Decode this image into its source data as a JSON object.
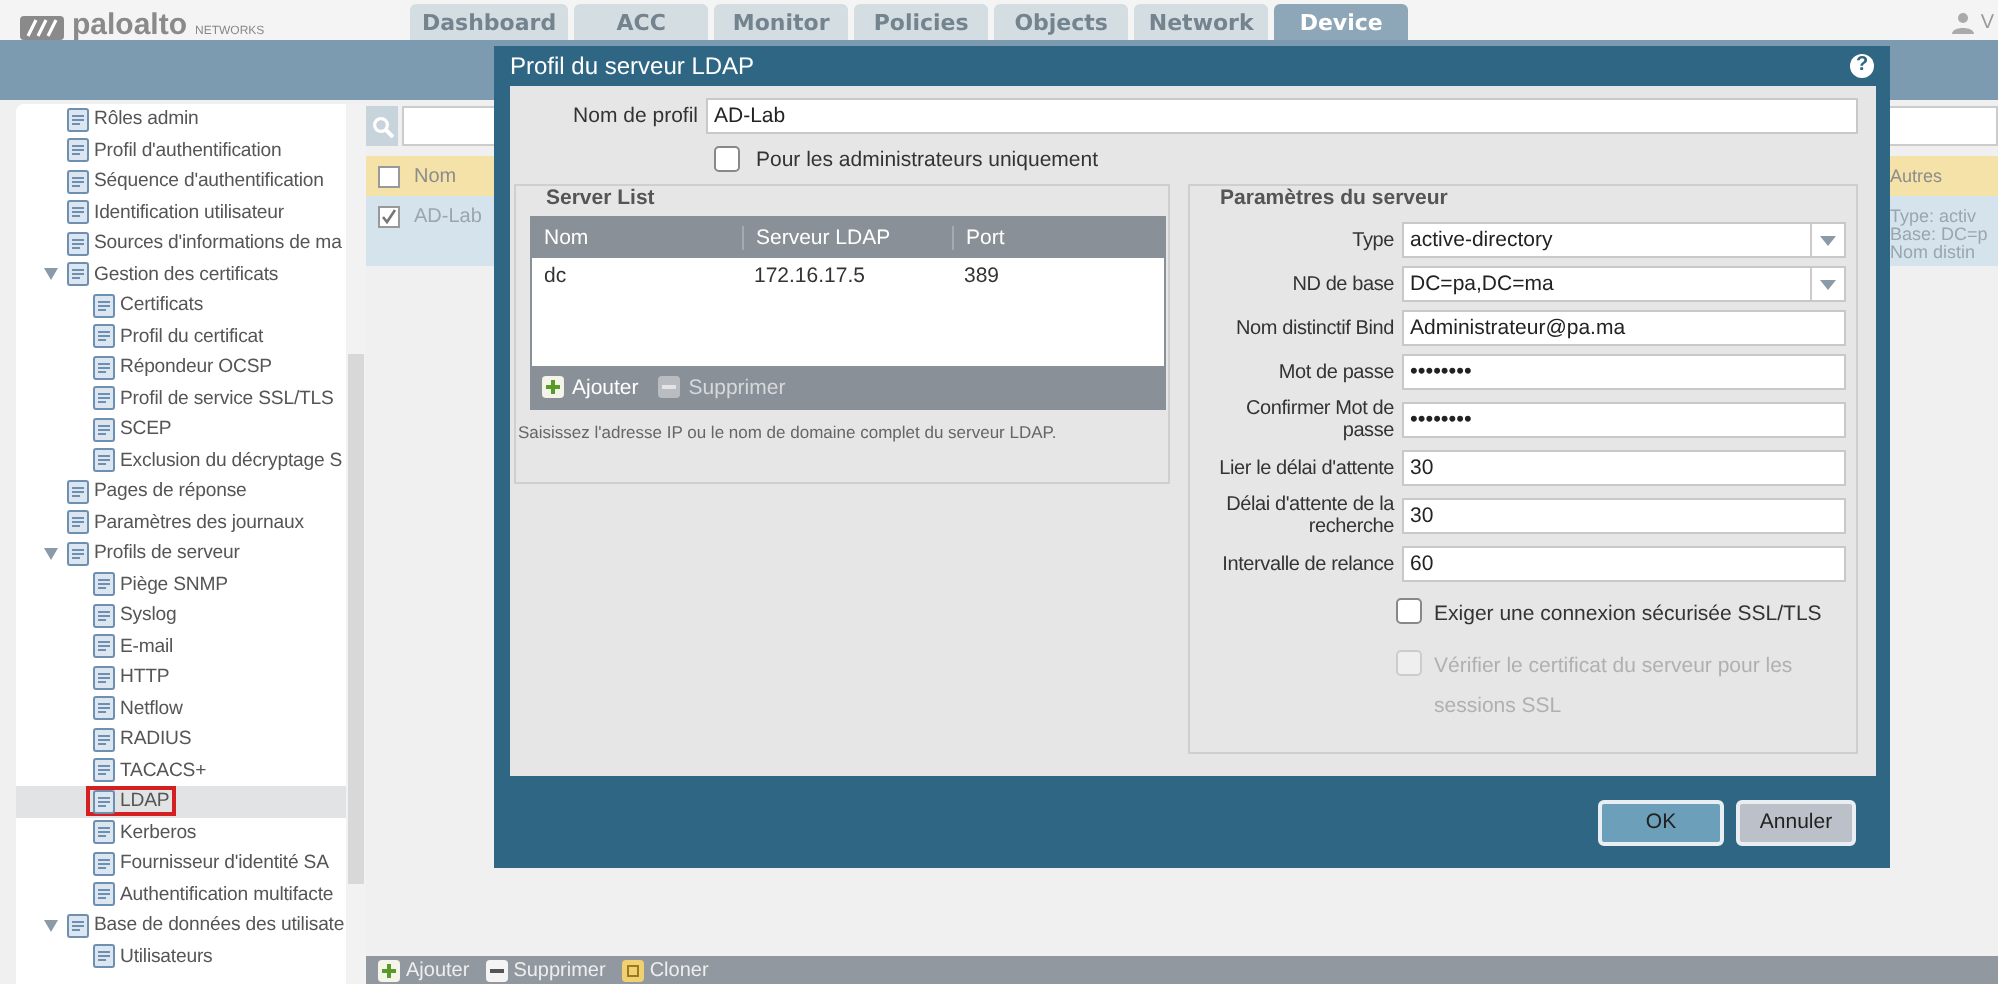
{
  "header": {
    "logo": {
      "wordmark": "paloalto",
      "tagline": "NETWORKS"
    },
    "tabs": [
      {
        "label": "Dashboard",
        "selected": false
      },
      {
        "label": "ACC",
        "selected": false
      },
      {
        "label": "Monitor",
        "selected": false
      },
      {
        "label": "Policies",
        "selected": false
      },
      {
        "label": "Objects",
        "selected": false
      },
      {
        "label": "Network",
        "selected": false
      },
      {
        "label": "Device",
        "selected": true
      }
    ],
    "user": "V"
  },
  "tree": {
    "items": [
      {
        "label": "Rôles admin",
        "selected": false
      },
      {
        "label": "Profil d'authentification",
        "selected": false
      },
      {
        "label": "Séquence d'authentification",
        "selected": false
      },
      {
        "label": "Identification utilisateur",
        "selected": false
      },
      {
        "label": "Sources d'informations de ma",
        "selected": false
      },
      {
        "label": "Gestion des certificats",
        "selected": false,
        "expanded": true,
        "children": [
          {
            "label": "Certificats",
            "selected": false
          },
          {
            "label": "Profil du certificat",
            "selected": false
          },
          {
            "label": "Répondeur OCSP",
            "selected": false
          },
          {
            "label": "Profil de service SSL/TLS",
            "selected": false
          },
          {
            "label": "SCEP",
            "selected": false
          },
          {
            "label": "Exclusion du décryptage S",
            "selected": false
          }
        ]
      },
      {
        "label": "Pages de réponse",
        "selected": false
      },
      {
        "label": "Paramètres des journaux",
        "selected": false
      },
      {
        "label": "Profils de serveur",
        "selected": false,
        "expanded": true,
        "children": [
          {
            "label": "Piège SNMP",
            "selected": false
          },
          {
            "label": "Syslog",
            "selected": false
          },
          {
            "label": "E-mail",
            "selected": false
          },
          {
            "label": "HTTP",
            "selected": false
          },
          {
            "label": "Netflow",
            "selected": false
          },
          {
            "label": "RADIUS",
            "selected": false
          },
          {
            "label": "TACACS+",
            "selected": false
          },
          {
            "label": "LDAP",
            "selected": true
          },
          {
            "label": "Kerberos",
            "selected": false
          },
          {
            "label": "Fournisseur d'identité SA",
            "selected": false
          },
          {
            "label": "Authentification multifacte",
            "selected": false
          }
        ]
      },
      {
        "label": "Base de données des utilisate",
        "selected": false,
        "expanded": true,
        "children": [
          {
            "label": "Utilisateurs",
            "selected": false
          }
        ]
      }
    ]
  },
  "main": {
    "table": {
      "header_checked": false,
      "columns": [
        "Nom",
        "Autres"
      ],
      "rows": [
        {
          "checked": true,
          "name": "AD-Lab",
          "autres": [
            "Type: activ",
            "Base: DC=p",
            "Nom distin"
          ]
        }
      ]
    },
    "actions": [
      {
        "label": "Ajouter",
        "kind": "add"
      },
      {
        "label": "Supprimer",
        "kind": "delete"
      },
      {
        "label": "Cloner",
        "kind": "clone"
      }
    ]
  },
  "dialog": {
    "title": "Profil du serveur LDAP",
    "help": "?",
    "profile_name": {
      "label": "Nom de profil",
      "value": "AD-Lab"
    },
    "admin_only": {
      "label": "Pour les administrateurs uniquement",
      "checked": false
    },
    "server_list": {
      "title": "Server List",
      "columns": [
        "Nom",
        "Serveur LDAP",
        "Port"
      ],
      "rows": [
        [
          "dc",
          "172.16.17.5",
          "389"
        ]
      ],
      "actions": [
        {
          "label": "Ajouter",
          "kind": "add",
          "disabled": false
        },
        {
          "label": "Supprimer",
          "kind": "delete",
          "disabled": true
        }
      ],
      "hint": "Saisissez l'adresse IP ou le nom de domaine complet du serveur LDAP."
    },
    "params": {
      "title": "Paramètres du serveur",
      "fields": [
        {
          "label": "Type",
          "kind": "select",
          "value": "active-directory"
        },
        {
          "label": "ND de base",
          "kind": "select",
          "value": "DC=pa,DC=ma"
        },
        {
          "label": "Nom distinctif Bind",
          "kind": "text",
          "value": "Administrateur@pa.ma"
        },
        {
          "label": "Mot de passe",
          "kind": "password",
          "value": "••••••••"
        },
        {
          "label": "Confirmer Mot de passe",
          "kind": "password",
          "value": "••••••••"
        },
        {
          "label": "Lier le délai d'attente",
          "kind": "text",
          "value": "30"
        },
        {
          "label": "Délai d'attente de la recherche",
          "kind": "text",
          "value": "30"
        },
        {
          "label": "Intervalle de relance",
          "kind": "text",
          "value": "60"
        }
      ],
      "options": [
        {
          "label": "Exiger une connexion sécurisée SSL/TLS",
          "checked": false,
          "disabled": false
        },
        {
          "label": "Vérifier le certificat du serveur pour les sessions SSL",
          "checked": false,
          "disabled": true
        }
      ]
    },
    "buttons": [
      {
        "label": "OK",
        "kind": "primary"
      },
      {
        "label": "Annuler",
        "kind": "secondary"
      }
    ]
  }
}
